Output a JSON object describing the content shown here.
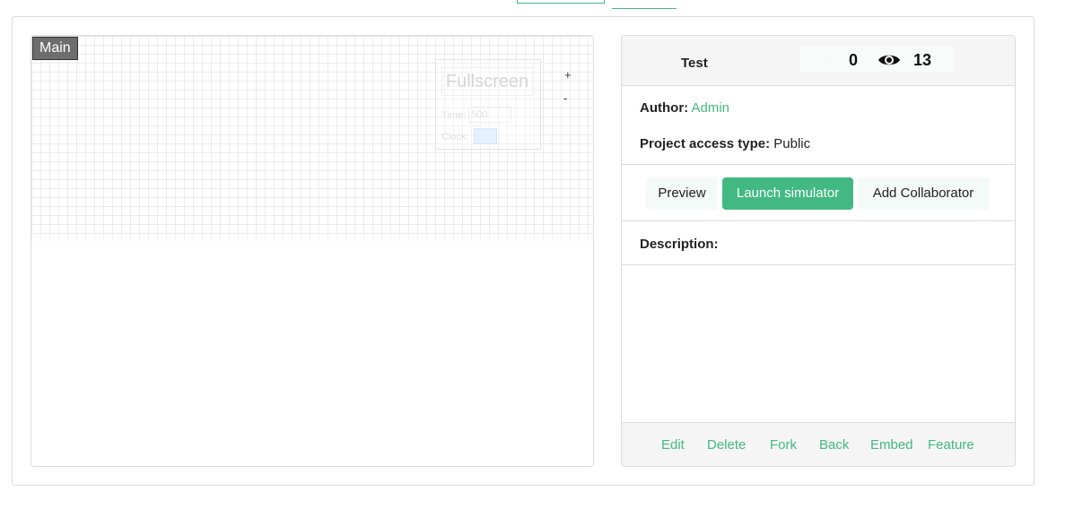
{
  "canvas": {
    "label": "Main",
    "fullscreen_label": "Fullscreen",
    "time_label": "Time:",
    "time_value": "500",
    "clock_label": "Clock:",
    "zoom_in": "+",
    "zoom_out": "-"
  },
  "project": {
    "title": "Test",
    "stars": "0",
    "views": "13",
    "author_label": "Author:",
    "author": "Admin",
    "access_label": "Project access type:",
    "access_type": "Public",
    "description_label": "Description:"
  },
  "actions": {
    "preview": "Preview",
    "launch": "Launch simulator",
    "collaborator": "Add Collaborator"
  },
  "footer": {
    "edit": "Edit",
    "delete": "Delete",
    "fork": "Fork",
    "back": "Back",
    "embed": "Embed",
    "feature": "Feature"
  },
  "colors": {
    "accent": "#42b983",
    "panel_bg": "#f5f5f5"
  }
}
